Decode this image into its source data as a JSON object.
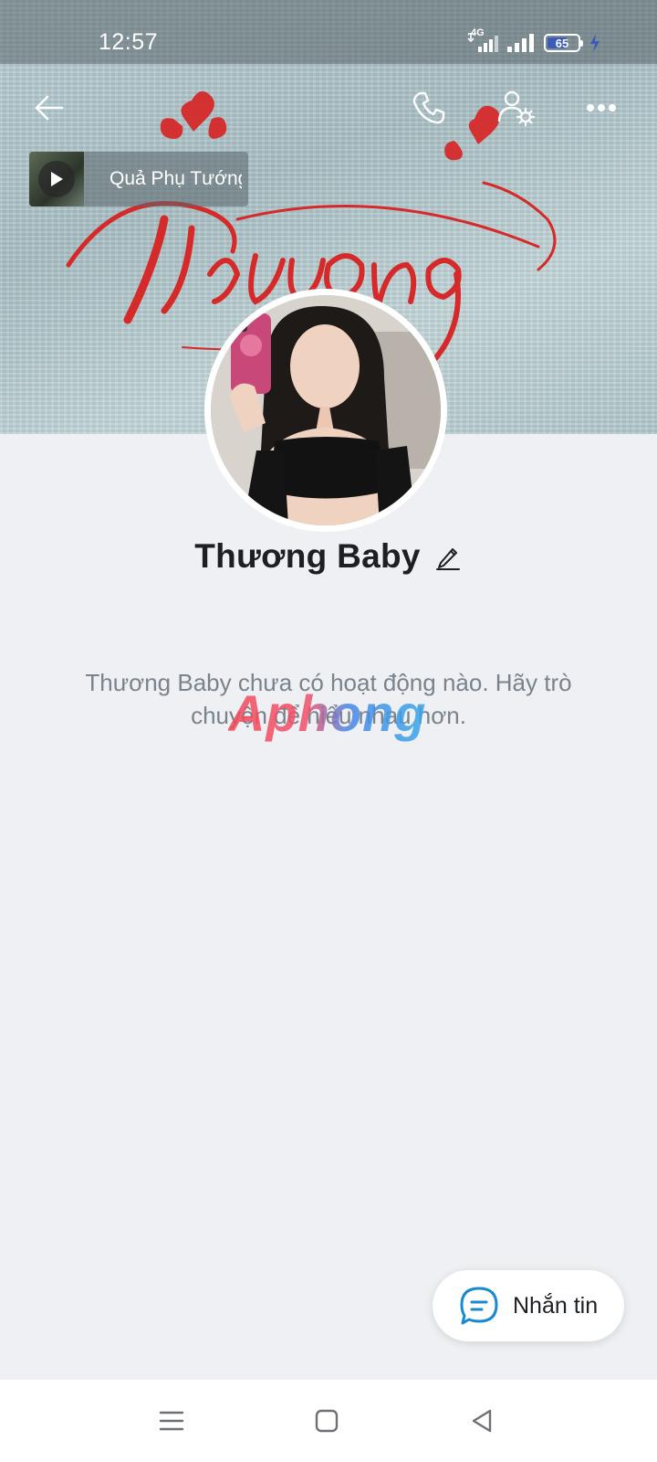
{
  "status_bar": {
    "time": "12:57",
    "network": "4G",
    "battery": "65",
    "battery_level": 0.65
  },
  "top_bar": {
    "back_icon": "arrow-left-icon",
    "call_icon": "phone-icon",
    "profile_settings_icon": "user-gear-icon",
    "more_icon": "more-horizontal-icon"
  },
  "cover": {
    "script_text": "Thương"
  },
  "music": {
    "title": "Quả Phụ Tướng",
    "icon": "play-icon"
  },
  "profile": {
    "name": "Thương Baby",
    "edit_icon": "pencil-icon"
  },
  "activity": {
    "empty_message": "Thương Baby chưa có hoạt động nào. Hãy trò chuyện để hiểu nhau hơn."
  },
  "watermark": {
    "text": "Aphong"
  },
  "actions": {
    "message_label": "Nhắn tin",
    "message_icon": "chat-bubble-icon"
  },
  "nav": {
    "menu_icon": "menu-icon",
    "home_icon": "square-icon",
    "back_icon": "triangle-back-icon"
  },
  "colors": {
    "accent": "#1a8ad0",
    "background": "#eef0f3",
    "cover_script": "#d62a2a"
  }
}
